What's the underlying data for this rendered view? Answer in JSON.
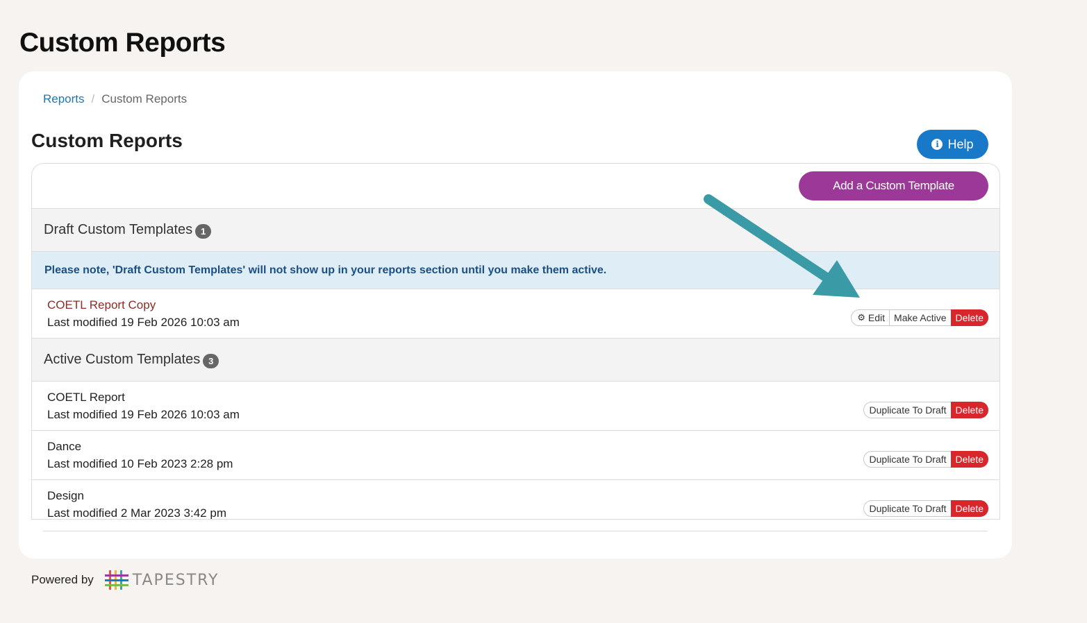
{
  "page": {
    "title": "Custom Reports"
  },
  "breadcrumb": {
    "link": "Reports",
    "separator": "/",
    "current": "Custom Reports"
  },
  "section": {
    "title": "Custom Reports"
  },
  "help": {
    "label": "Help",
    "icon": "info-circle-icon"
  },
  "add_button": {
    "label": "Add a Custom Template"
  },
  "draft": {
    "header": "Draft Custom Templates",
    "count": "1",
    "notice": "Please note, 'Draft Custom Templates' will not show up in your reports section until you make them active.",
    "items": [
      {
        "name": "COETL Report Copy",
        "modified": "Last modified 19 Feb 2026 10:03 am",
        "edit_label": "Edit",
        "make_active_label": "Make Active",
        "delete_label": "Delete"
      }
    ]
  },
  "active": {
    "header": "Active Custom Templates",
    "count": "3",
    "items": [
      {
        "name": "COETL Report",
        "modified": "Last modified 19 Feb 2026 10:03 am",
        "duplicate_label": "Duplicate To Draft",
        "delete_label": "Delete"
      },
      {
        "name": "Dance",
        "modified": "Last modified 10 Feb 2023 2:28 pm",
        "duplicate_label": "Duplicate To Draft",
        "delete_label": "Delete"
      },
      {
        "name": "Design",
        "modified": "Last modified 2 Mar 2023 3:42 pm",
        "duplicate_label": "Duplicate To Draft",
        "delete_label": "Delete"
      }
    ]
  },
  "footer": {
    "powered_by": "Powered by",
    "brand": "TAPESTRY"
  },
  "colors": {
    "primary": "#1779c8",
    "accent": "#9b3898",
    "danger": "#d7262c",
    "notice_bg": "#dfeef6",
    "annotation_arrow": "#3a9aa6"
  }
}
